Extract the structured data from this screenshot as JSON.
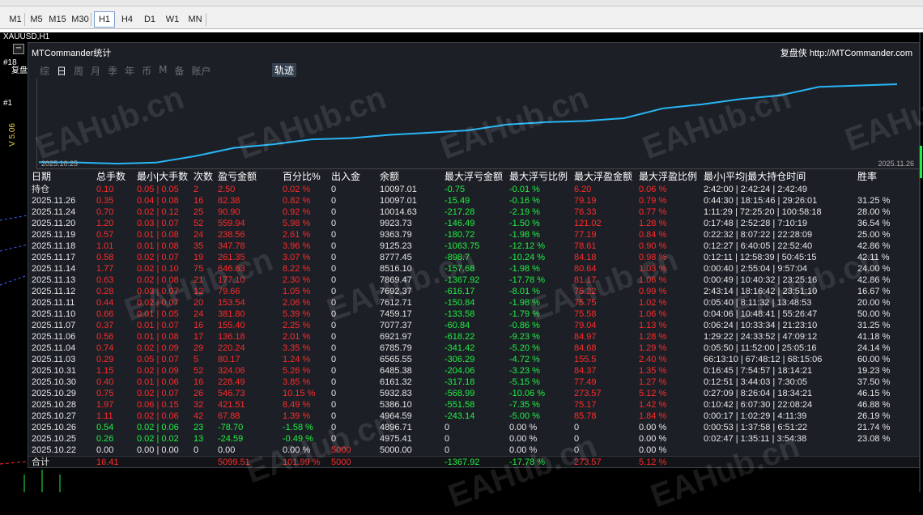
{
  "timeframes": [
    "M1",
    "M5",
    "M15",
    "M30",
    "H1",
    "H4",
    "D1",
    "W1",
    "MN"
  ],
  "active_timeframe": "H1",
  "symbol": "XAUUSD,H1",
  "vertical_label": "V 5.06",
  "side_labels": [
    "#18",
    "复盘",
    "#1"
  ],
  "panel": {
    "title": "MTCommander统计",
    "link": "复盘侠 http://MTCommander.com",
    "tabs": [
      "综",
      "日",
      "周",
      "月",
      "季",
      "年",
      "币",
      "M",
      "备",
      "账户"
    ],
    "selected_tab": "日",
    "trace_tab": "轨迹",
    "chart_start_date": "2025.10.25",
    "chart_end_date": "2025.11.26",
    "line_color": "#29b6f6"
  },
  "table": {
    "headers": [
      "日期",
      "总手数",
      "最小|大手数",
      "次数",
      "盈亏金额",
      "百分比%",
      "出入金",
      "余额",
      "最大浮亏金额",
      "最大浮亏比例",
      "最大浮盈金额",
      "最大浮盈比例",
      "最小|平均|最大持仓时间",
      "胜率"
    ],
    "rows": [
      {
        "c": [
          "持仓",
          "0.10",
          "0.05 | 0.05",
          "2",
          "2.50",
          "0.02 %",
          "0",
          "10097.01",
          "-0.75",
          "-0.01 %",
          "6.20",
          "0.06 %",
          "2:42:00 | 2:42:24 | 2:42:49",
          ""
        ],
        "s": "r"
      },
      {
        "c": [
          "2025.11.26",
          "0.35",
          "0.04 | 0.08",
          "16",
          "82.38",
          "0.82 %",
          "0",
          "10097.01",
          "-15.49",
          "-0.16 %",
          "79.19",
          "0.79 %",
          "0:44:30 | 18:15:46 | 29:26:01",
          "31.25 %"
        ],
        "s": "r"
      },
      {
        "c": [
          "2025.11.24",
          "0.70",
          "0.02 | 0.12",
          "25",
          "90.90",
          "0.92 %",
          "0",
          "10014.63",
          "-217.28",
          "-2.19 %",
          "76.33",
          "0.77 %",
          "1:11:29 | 72:25:20 | 100:58:18",
          "28.00 %"
        ],
        "s": "r"
      },
      {
        "c": [
          "2025.11.20",
          "1.20",
          "0.03 | 0.07",
          "52",
          "559.94",
          "5.98 %",
          "0",
          "9923.73",
          "-146.49",
          "-1.50 %",
          "121.02",
          "1.28 %",
          "0:17:48 | 2:52:28 | 7:10:19",
          "36.54 %"
        ],
        "s": "r"
      },
      {
        "c": [
          "2025.11.19",
          "0.57",
          "0.01 | 0.08",
          "24",
          "238.56",
          "2.61 %",
          "0",
          "9363.79",
          "-180.72",
          "-1.98 %",
          "77.19",
          "0.84 %",
          "0:22:32 | 8:07:22 | 22:28:09",
          "25.00 %"
        ],
        "s": "r"
      },
      {
        "c": [
          "2025.11.18",
          "1.01",
          "0.01 | 0.08",
          "35",
          "347.78",
          "3.96 %",
          "0",
          "9125.23",
          "-1063.75",
          "-12.12 %",
          "78.61",
          "0.90 %",
          "0:12:27 | 6:40:05 | 22:52:40",
          "42.86 %"
        ],
        "s": "r"
      },
      {
        "c": [
          "2025.11.17",
          "0.58",
          "0.02 | 0.07",
          "19",
          "261.35",
          "3.07 %",
          "0",
          "8777.45",
          "-898.7",
          "-10.24 %",
          "84.18",
          "0.98 %",
          "0:12:11 | 12:58:39 | 50:45:15",
          "42.11 %"
        ],
        "s": "r"
      },
      {
        "c": [
          "2025.11.14",
          "1.77",
          "0.02 | 0.10",
          "75",
          "646.63",
          "8.22 %",
          "0",
          "8516.10",
          "-157.68",
          "-1.98 %",
          "80.64",
          "1.03 %",
          "0:00:40 | 2:55:04 | 9:57:04",
          "24.00 %"
        ],
        "s": "r"
      },
      {
        "c": [
          "2025.11.13",
          "0.63",
          "0.02 | 0.08",
          "21",
          "177.10",
          "2.30 %",
          "0",
          "7869.47",
          "-1367.92",
          "-17.78 %",
          "81.17",
          "1.06 %",
          "0:00:49 | 10:40:32 | 23:25:16",
          "42.86 %"
        ],
        "s": "r"
      },
      {
        "c": [
          "2025.11.12",
          "0.28",
          "0.03 | 0.07",
          "12",
          "79.66",
          "1.05 %",
          "0",
          "7692.37",
          "-616.17",
          "-8.01 %",
          "75.22",
          "0.99 %",
          "2:43:14 | 18:16:42 | 23:51:10",
          "16.67 %"
        ],
        "s": "r"
      },
      {
        "c": [
          "2025.11.11",
          "0.44",
          "0.02 | 0.07",
          "20",
          "153.54",
          "2.06 %",
          "0",
          "7612.71",
          "-150.84",
          "-1.98 %",
          "75.75",
          "1.02 %",
          "0:05:40 | 8:11:32 | 13:48:53",
          "20.00 %"
        ],
        "s": "r"
      },
      {
        "c": [
          "2025.11.10",
          "0.66",
          "0.01 | 0.05",
          "24",
          "381.80",
          "5.39 %",
          "0",
          "7459.17",
          "-133.58",
          "-1.79 %",
          "75.58",
          "1.06 %",
          "0:04:06 | 10:48:41 | 55:26:47",
          "50.00 %"
        ],
        "s": "r"
      },
      {
        "c": [
          "2025.11.07",
          "0.37",
          "0.01 | 0.07",
          "16",
          "155.40",
          "2.25 %",
          "0",
          "7077.37",
          "-60.84",
          "-0.86 %",
          "79.04",
          "1.13 %",
          "0:06:24 | 10:33:34 | 21:23:10",
          "31.25 %"
        ],
        "s": "r"
      },
      {
        "c": [
          "2025.11.06",
          "0.56",
          "0.01 | 0.08",
          "17",
          "136.18",
          "2.01 %",
          "0",
          "6921.97",
          "-618.22",
          "-9.23 %",
          "84.97",
          "1.28 %",
          "1:29:22 | 24:33:52 | 47:09:12",
          "41.18 %"
        ],
        "s": "r"
      },
      {
        "c": [
          "2025.11.04",
          "0.74",
          "0.02 | 0.09",
          "29",
          "220.24",
          "3.35 %",
          "0",
          "6785.79",
          "-341.42",
          "-5.20 %",
          "84.68",
          "1.29 %",
          "0:05:50 | 11:52:00 | 25:05:16",
          "24.14 %"
        ],
        "s": "r"
      },
      {
        "c": [
          "2025.11.03",
          "0.29",
          "0.05 | 0.07",
          "5",
          "80.17",
          "1.24 %",
          "0",
          "6565.55",
          "-306.29",
          "-4.72 %",
          "155.5",
          "2.40 %",
          "66:13:10 | 67:48:12 | 68:15:06",
          "60.00 %"
        ],
        "s": "r"
      },
      {
        "c": [
          "2025.10.31",
          "1.15",
          "0.02 | 0.09",
          "52",
          "324.06",
          "5.26 %",
          "0",
          "6485.38",
          "-204.06",
          "-3.23 %",
          "84.37",
          "1.35 %",
          "0:16:45 | 7:54:57 | 18:14:21",
          "19.23 %"
        ],
        "s": "r"
      },
      {
        "c": [
          "2025.10.30",
          "0.40",
          "0.01 | 0.06",
          "16",
          "228.49",
          "3.85 %",
          "0",
          "6161.32",
          "-317.18",
          "-5.15 %",
          "77.49",
          "1.27 %",
          "0:12:51 | 3:44:03 | 7:30:05",
          "37.50 %"
        ],
        "s": "r"
      },
      {
        "c": [
          "2025.10.29",
          "0.75",
          "0.02 | 0.07",
          "26",
          "546.73",
          "10.15 %",
          "0",
          "5932.83",
          "-568.99",
          "-10.06 %",
          "273.57",
          "5.12 %",
          "0:27:09 | 8:26:04 | 18:34:21",
          "46.15 %"
        ],
        "s": "r"
      },
      {
        "c": [
          "2025.10.28",
          "1.97",
          "0.06 | 0.15",
          "32",
          "421.51",
          "8.49 %",
          "0",
          "5386.10",
          "-551.58",
          "-7.35 %",
          "75.17",
          "1.42 %",
          "0:10:42 | 6:07:30 | 22:08:24",
          "46.88 %"
        ],
        "s": "r"
      },
      {
        "c": [
          "2025.10.27",
          "1.11",
          "0.02 | 0.06",
          "42",
          "67.88",
          "1.39 %",
          "0",
          "4964.59",
          "-243.14",
          "-5.00 %",
          "85.78",
          "1.84 %",
          "0:00:17 | 1:02:29 | 4:11:39",
          "26.19 %"
        ],
        "s": "r"
      },
      {
        "c": [
          "2025.10.26",
          "0.54",
          "0.02 | 0.06",
          "23",
          "-78.70",
          "-1.58 %",
          "0",
          "4896.71",
          "0",
          "0.00 %",
          "0",
          "0.00 %",
          "0:00:53 | 1:37:58 | 6:51:22",
          "21.74 %"
        ],
        "s": "g"
      },
      {
        "c": [
          "2025.10.25",
          "0.26",
          "0.02 | 0.02",
          "13",
          "-24.59",
          "-0.49 %",
          "0",
          "4975.41",
          "0",
          "0.00 %",
          "0",
          "0.00 %",
          "0:02:47 | 1:35:11 | 3:54:38",
          "23.08 %"
        ],
        "s": "g"
      },
      {
        "c": [
          "2025.10.22",
          "0.00",
          "0.00 | 0.00",
          "0",
          "0.00",
          "0.00 %",
          "5000",
          "5000.00",
          "0",
          "0.00 %",
          "0",
          "0.00 %",
          "",
          ""
        ],
        "s": "w"
      }
    ],
    "footer": [
      "合计",
      "16.41",
      "",
      "",
      "5099.51",
      "101.99 %",
      "5000",
      "",
      "-1367.92",
      "-17.78 %",
      "273.57",
      "5.12 %",
      "",
      ""
    ]
  },
  "watermark": "EAHub.cn"
}
